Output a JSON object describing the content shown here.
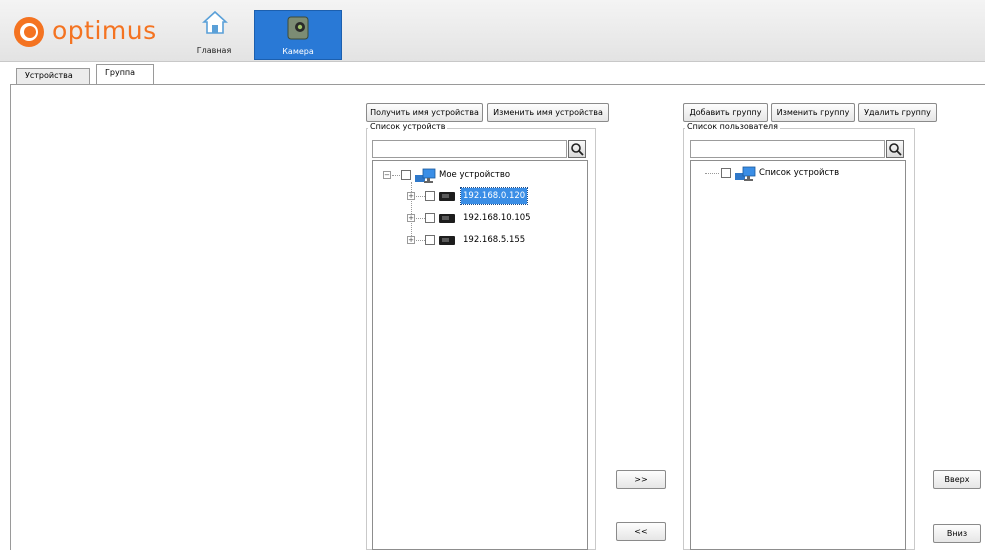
{
  "app": {
    "logo_text": "optimus",
    "brand_color": "#f47321",
    "accent_color": "#2979d6"
  },
  "nav": {
    "home_label": "Главная",
    "camera_label": "Камера"
  },
  "tabs": [
    {
      "label": "Устройства"
    },
    {
      "label": "Группа",
      "active": true
    }
  ],
  "device_panel": {
    "get_name_button": "Получить имя устройства",
    "rename_button": "Изменить имя устройства",
    "title": "Список устройств",
    "search_value": "",
    "root": "Мое устройство",
    "devices": [
      {
        "ip": "192.168.0.120",
        "selected": true
      },
      {
        "ip": "192.168.10.105",
        "selected": false
      },
      {
        "ip": "192.168.5.155",
        "selected": false
      }
    ]
  },
  "transfer": {
    "add_label": ">>",
    "remove_label": "<<"
  },
  "user_panel": {
    "add_group_button": "Добавить группу",
    "edit_group_button": "Изменить группу",
    "delete_group_button": "Удалить группу",
    "title": "Список пользователя",
    "search_value": "",
    "root": "Список устройств"
  },
  "order": {
    "up_label": "Вверх",
    "down_label": "Вниз"
  }
}
